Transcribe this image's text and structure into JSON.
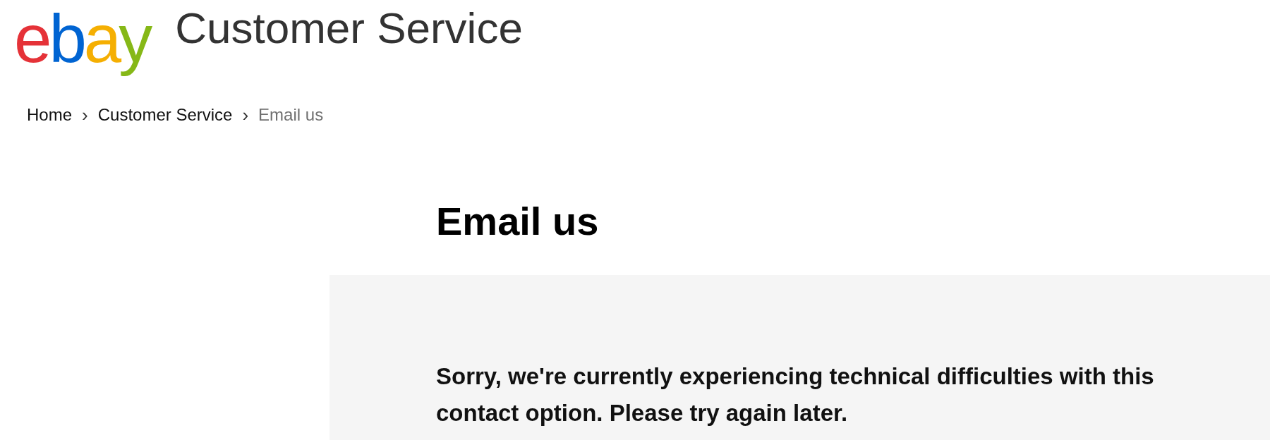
{
  "header": {
    "logo": [
      {
        "letter": "e",
        "color": "#e53238"
      },
      {
        "letter": "b",
        "color": "#0064d2"
      },
      {
        "letter": "a",
        "color": "#f5af02"
      },
      {
        "letter": "y",
        "color": "#86b817"
      }
    ],
    "title": "Customer Service"
  },
  "breadcrumb": [
    {
      "label": "Home",
      "current": false
    },
    {
      "label": "Customer Service",
      "current": false
    },
    {
      "label": "Email us",
      "current": true
    }
  ],
  "separator": "›",
  "heading": "Email us",
  "message": "Sorry, we're currently experiencing technical difficulties with this contact option. Please try again later."
}
